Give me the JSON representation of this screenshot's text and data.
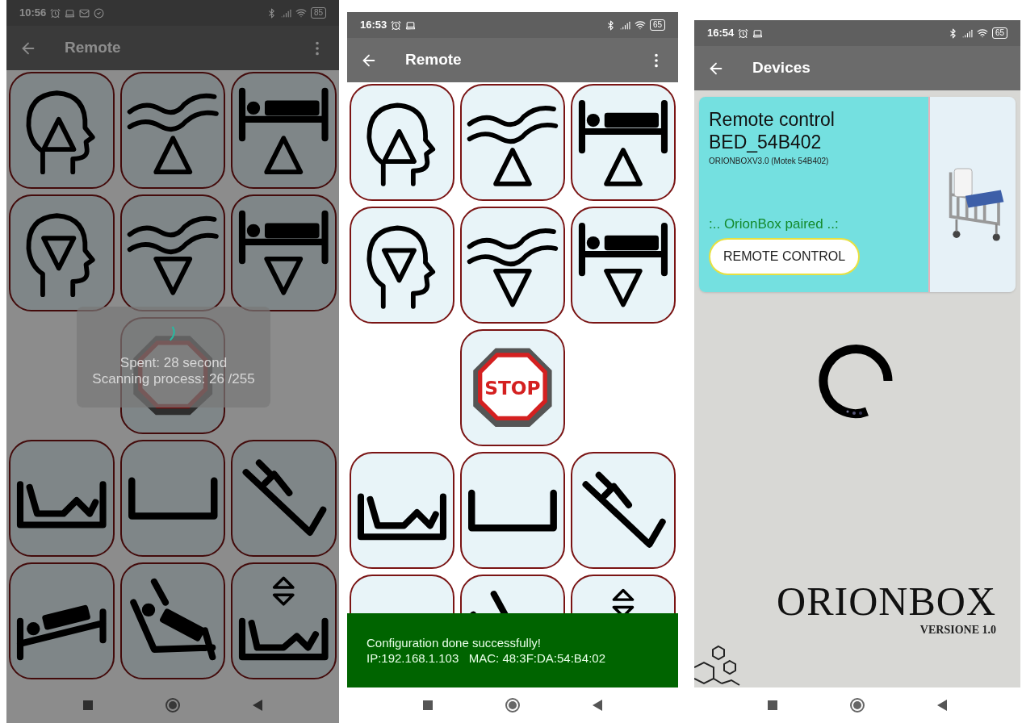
{
  "screens": [
    {
      "kind": "remote",
      "status_bar": {
        "time": "10:56",
        "battery": "85",
        "notification_icons": true
      },
      "title": "Remote",
      "menu": true,
      "progress_dialog": {
        "lines": [
          "Spent: 28 second",
          "Scanning process: 26 /255"
        ]
      }
    },
    {
      "kind": "remote",
      "status_bar": {
        "time": "16:53",
        "battery": "65",
        "notification_icons": false
      },
      "title": "Remote",
      "menu": true,
      "stop_label": "STOP",
      "snackbar": {
        "lines": [
          "Configuration done successfully!",
          "IP:192.168.1.103   MAC: 48:3F:DA:54:B4:02"
        ]
      }
    },
    {
      "kind": "devices",
      "status_bar": {
        "time": "16:54",
        "battery": "65",
        "notification_icons": false
      },
      "title": "Devices",
      "menu": false,
      "device_card": {
        "title": "Remote control BED_54B402",
        "subtitle": "ORIONBOXV3.0 (Motek 54B402)",
        "status": ":.. OrionBox paired ..:",
        "button": "REMOTE CONTROL"
      },
      "logo": {
        "name": "ORIONBOX",
        "version": "VERSIONE 1.0"
      }
    }
  ]
}
